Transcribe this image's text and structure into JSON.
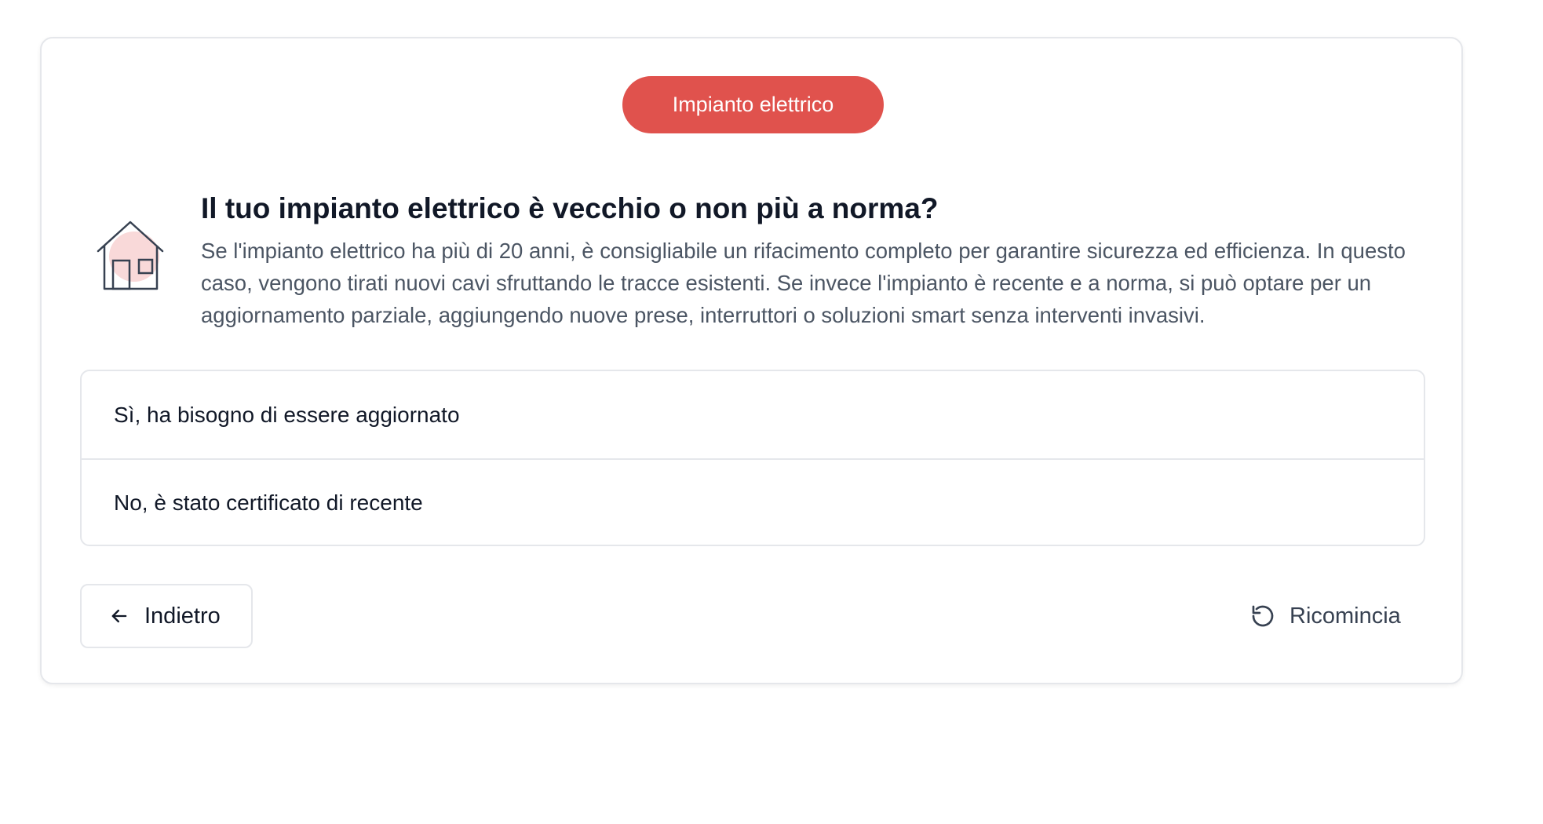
{
  "category_badge": "Impianto elettrico",
  "question": {
    "icon": "house-icon",
    "title": "Il tuo impianto elettrico è vecchio o non più a norma?",
    "description": "Se l'impianto elettrico ha più di 20 anni, è consigliabile un rifacimento completo per garantire sicurezza ed efficienza. In questo caso, vengono tirati nuovi cavi sfruttando le tracce esistenti. Se invece l'impianto è recente e a norma, si può optare per un aggiornamento parziale, aggiungendo nuove prese, interruttori o soluzioni smart senza interventi invasivi."
  },
  "options": [
    {
      "label": "Sì, ha bisogno di essere aggiornato"
    },
    {
      "label": "No, è stato certificato di recente"
    }
  ],
  "navigation": {
    "back_label": "Indietro",
    "back_icon": "arrow-left-icon",
    "restart_label": "Ricomincia",
    "restart_icon": "restart-icon"
  },
  "colors": {
    "accent": "#e0524d",
    "icon_highlight": "#f9d9d9"
  }
}
